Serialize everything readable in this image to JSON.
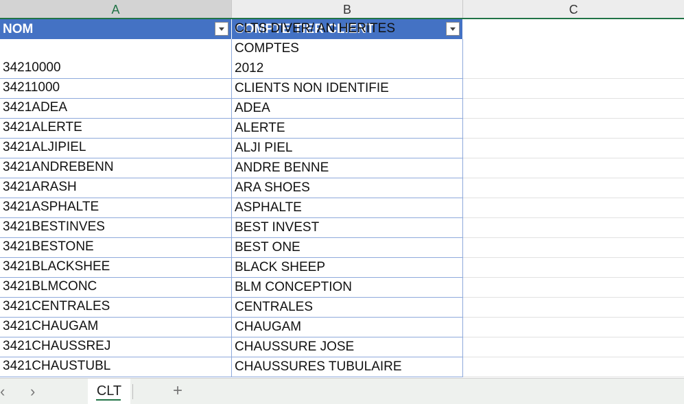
{
  "columns": [
    "A",
    "B",
    "C"
  ],
  "table": {
    "headers": [
      "NOM",
      "COMPTE TIER CLIENT"
    ],
    "rows": [
      {
        "nom": "34210000",
        "compte": [
          "CLTS DIVER/ AN HERITES COMPTES",
          "2012"
        ]
      },
      {
        "nom": "34211000",
        "compte": [
          "CLIENTS NON IDENTIFIE"
        ]
      },
      {
        "nom": "3421ADEA",
        "compte": [
          "ADEA"
        ]
      },
      {
        "nom": "3421ALERTE",
        "compte": [
          "ALERTE"
        ]
      },
      {
        "nom": "3421ALJIPIEL",
        "compte": [
          "ALJI PIEL"
        ]
      },
      {
        "nom": "3421ANDREBENN",
        "compte": [
          "ANDRE BENNE"
        ]
      },
      {
        "nom": "3421ARASH",
        "compte": [
          "ARA SHOES"
        ]
      },
      {
        "nom": "3421ASPHALTE",
        "compte": [
          "ASPHALTE"
        ]
      },
      {
        "nom": "3421BESTINVES",
        "compte": [
          "BEST INVEST"
        ]
      },
      {
        "nom": "3421BESTONE",
        "compte": [
          "BEST  ONE"
        ]
      },
      {
        "nom": "3421BLACKSHEE",
        "compte": [
          "BLACK SHEEP"
        ]
      },
      {
        "nom": "3421BLMCONC",
        "compte": [
          "BLM CONCEPTION"
        ]
      },
      {
        "nom": "3421CENTRALES",
        "compte": [
          "CENTRALES"
        ]
      },
      {
        "nom": "3421CHAUGAM",
        "compte": [
          "CHAUGAM"
        ]
      },
      {
        "nom": "3421CHAUSSREJ",
        "compte": [
          "CHAUSSURE JOSE"
        ]
      },
      {
        "nom": "3421CHAUSTUBL",
        "compte": [
          "CHAUSSURES TUBULAIRE"
        ]
      }
    ]
  },
  "sheet_tabs": {
    "nav_prev": "‹",
    "nav_next": "›",
    "active": "CLT",
    "add": "+"
  },
  "colors": {
    "header_fill": "#4472c4",
    "accent": "#217346",
    "border": "#8ea9db"
  }
}
